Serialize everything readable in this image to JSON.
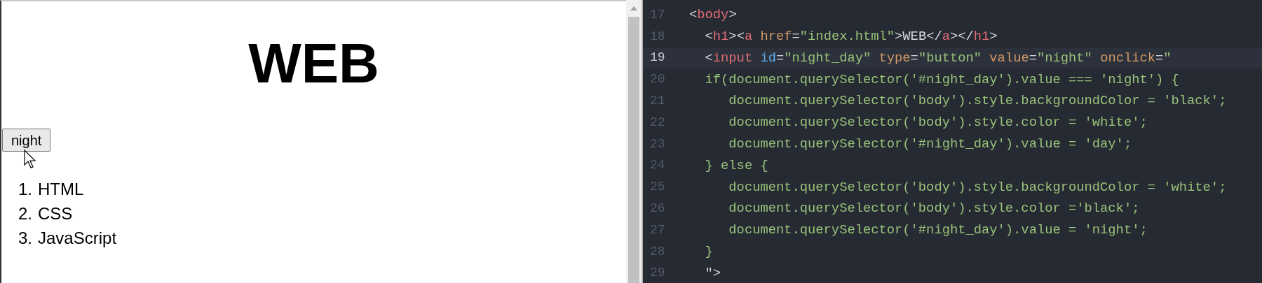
{
  "preview": {
    "heading": "WEB",
    "button": "night",
    "list": [
      {
        "number": "1.",
        "text": "HTML"
      },
      {
        "number": "2.",
        "text": "CSS"
      },
      {
        "number": "3.",
        "text": "JavaScript"
      }
    ]
  },
  "editor": {
    "lines": [
      {
        "number": "17",
        "active": false,
        "tokens": [
          {
            "kind": "punct",
            "text": "<"
          },
          {
            "kind": "tag",
            "text": "body"
          },
          {
            "kind": "punct",
            "text": ">"
          }
        ]
      },
      {
        "number": "18",
        "active": false,
        "tokens": [
          {
            "kind": "punct",
            "text": "  <"
          },
          {
            "kind": "tag",
            "text": "h1"
          },
          {
            "kind": "punct",
            "text": "><"
          },
          {
            "kind": "tag",
            "text": "a"
          },
          {
            "kind": "attr",
            "text": " href"
          },
          {
            "kind": "punct",
            "text": "="
          },
          {
            "kind": "string",
            "text": "\"index.html\""
          },
          {
            "kind": "punct",
            "text": ">WEB</"
          },
          {
            "kind": "tag",
            "text": "a"
          },
          {
            "kind": "punct",
            "text": "></"
          },
          {
            "kind": "tag",
            "text": "h1"
          },
          {
            "kind": "punct",
            "text": ">"
          }
        ]
      },
      {
        "number": "19",
        "active": true,
        "tokens": [
          {
            "kind": "punct",
            "text": "  <"
          },
          {
            "kind": "tag",
            "text": "input"
          },
          {
            "kind": "id",
            "text": " id"
          },
          {
            "kind": "punct",
            "text": "="
          },
          {
            "kind": "string",
            "text": "\"night_day\""
          },
          {
            "kind": "attr",
            "text": " type"
          },
          {
            "kind": "punct",
            "text": "="
          },
          {
            "kind": "string",
            "text": "\"button\""
          },
          {
            "kind": "attr",
            "text": " value"
          },
          {
            "kind": "punct",
            "text": "="
          },
          {
            "kind": "string",
            "text": "\"night\""
          },
          {
            "kind": "attr",
            "text": " onclick"
          },
          {
            "kind": "punct",
            "text": "="
          },
          {
            "kind": "string",
            "text": "\""
          }
        ]
      },
      {
        "number": "20",
        "active": false,
        "tokens": [
          {
            "kind": "string",
            "text": "  if(document.querySelector('#night_day').value === 'night') {"
          }
        ]
      },
      {
        "number": "21",
        "active": false,
        "tokens": [
          {
            "kind": "string",
            "text": "     document.querySelector('body').style.backgroundColor = 'black';"
          }
        ]
      },
      {
        "number": "22",
        "active": false,
        "tokens": [
          {
            "kind": "string",
            "text": "     document.querySelector('body').style.color = 'white';"
          }
        ]
      },
      {
        "number": "23",
        "active": false,
        "tokens": [
          {
            "kind": "string",
            "text": "     document.querySelector('#night_day').value = 'day';"
          }
        ]
      },
      {
        "number": "24",
        "active": false,
        "tokens": [
          {
            "kind": "string",
            "text": "  } else {"
          }
        ]
      },
      {
        "number": "25",
        "active": false,
        "tokens": [
          {
            "kind": "string",
            "text": "     document.querySelector('body').style.backgroundColor = 'white';"
          }
        ]
      },
      {
        "number": "26",
        "active": false,
        "tokens": [
          {
            "kind": "string",
            "text": "     document.querySelector('body').style.color ='black';"
          }
        ]
      },
      {
        "number": "27",
        "active": false,
        "tokens": [
          {
            "kind": "string",
            "text": "     document.querySelector('#night_day').value = 'night';"
          }
        ]
      },
      {
        "number": "28",
        "active": false,
        "tokens": [
          {
            "kind": "string",
            "text": "  }"
          }
        ]
      },
      {
        "number": "29",
        "active": false,
        "tokens": [
          {
            "kind": "punct",
            "text": "  \">"
          }
        ]
      }
    ]
  }
}
